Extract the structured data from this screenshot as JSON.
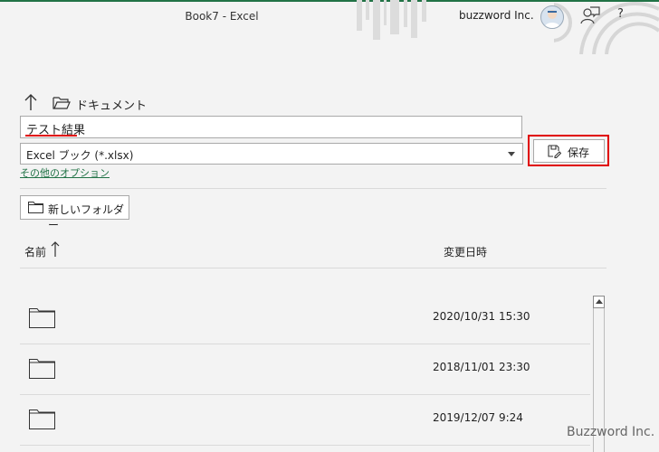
{
  "titlebar": {
    "window_title": "Book7  -  Excel",
    "account_name": "buzzword Inc.",
    "help": "?"
  },
  "breadcrumb": {
    "location": "ドキュメント"
  },
  "filename": {
    "value": "テスト結果"
  },
  "filetype": {
    "value": "Excel ブック (*.xlsx)"
  },
  "more_options": "その他のオプション",
  "save_button": {
    "label": "保存"
  },
  "new_folder_button": {
    "label": "新しいフォルダー"
  },
  "file_list": {
    "columns": {
      "name": "名前",
      "date": "変更日時"
    },
    "rows": [
      {
        "date": "2020/10/31 15:30"
      },
      {
        "date": "2018/11/01 23:30"
      },
      {
        "date": "2019/12/07 9:24"
      }
    ]
  },
  "watermark": "Buzzword Inc.",
  "colors": {
    "accent": "#217346",
    "highlight": "#e00000"
  }
}
